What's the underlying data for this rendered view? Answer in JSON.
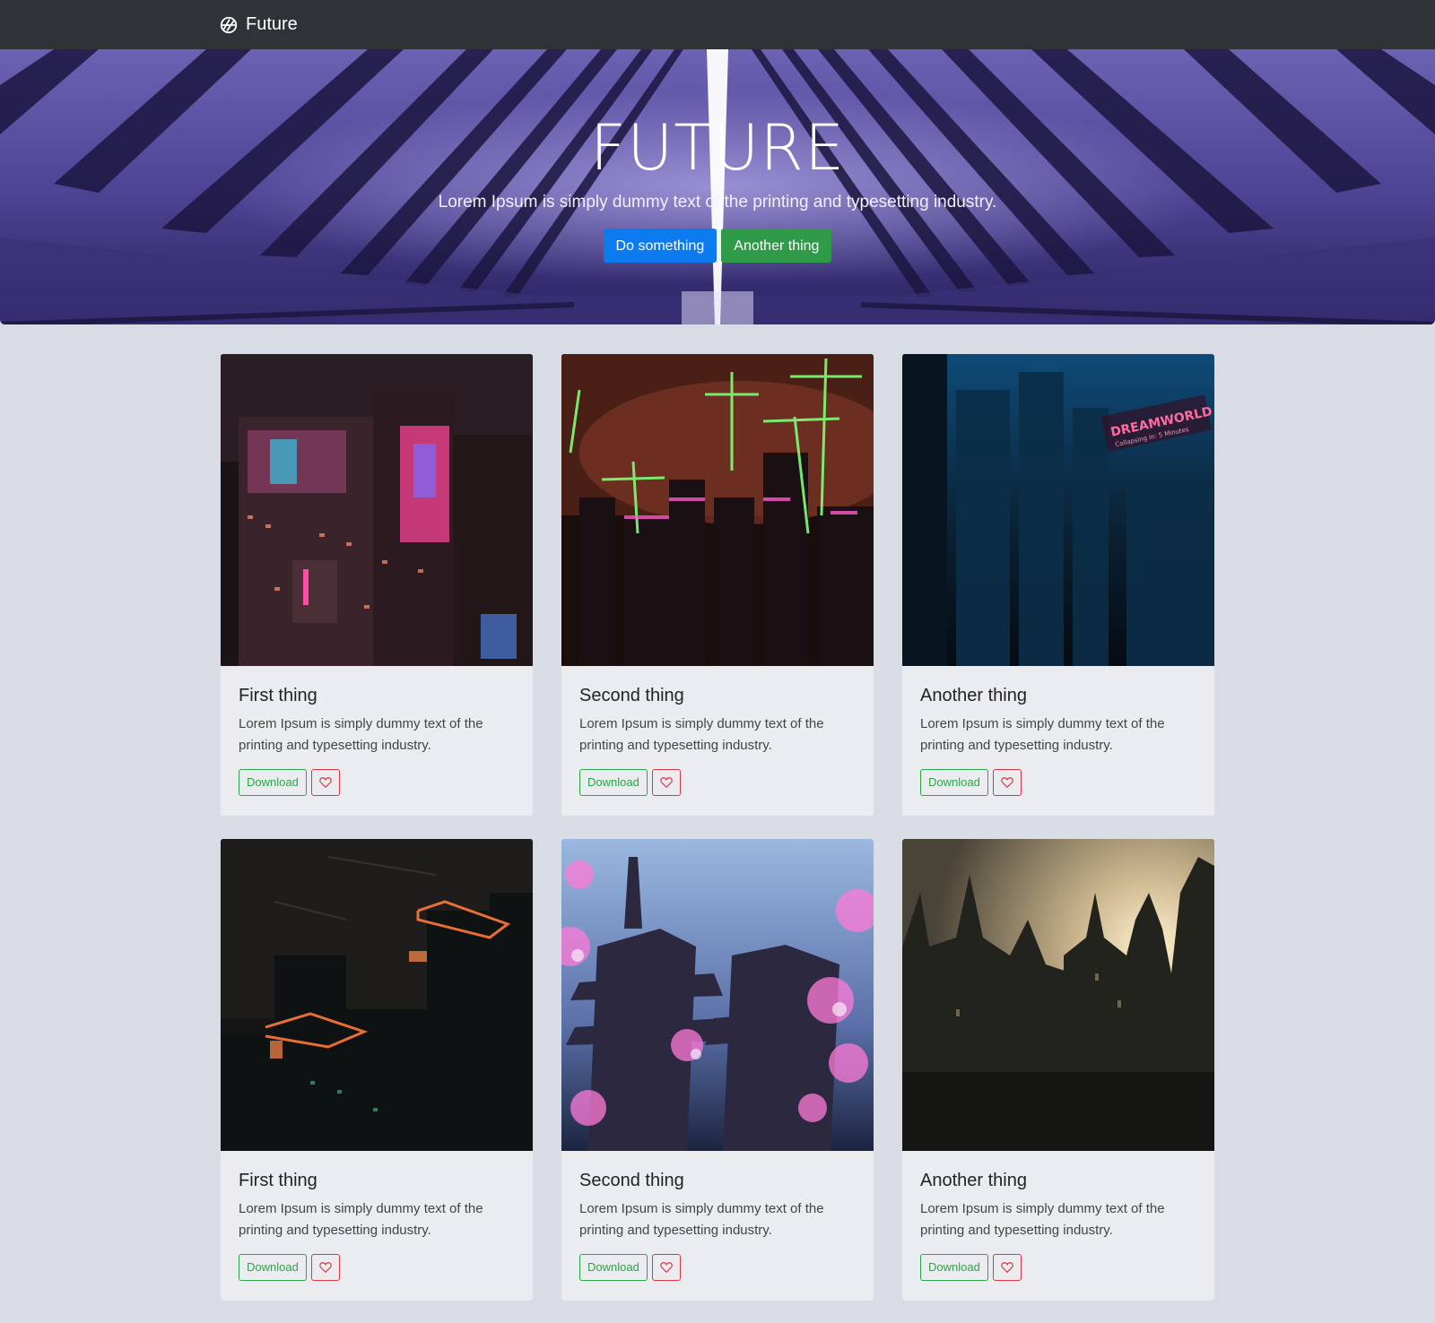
{
  "navbar": {
    "brand": "Future",
    "icon": "camera-aperture-icon"
  },
  "hero": {
    "title": "FUTURE",
    "subtitle": "Lorem Ipsum is simply dummy text of the printing and typesetting industry.",
    "primary_button": "Do something",
    "secondary_button": "Another thing"
  },
  "colors": {
    "primary": "#0d7bf0",
    "success": "#28a745",
    "danger": "#dc3545",
    "navbar": "#2f3338"
  },
  "cards": [
    {
      "title": "First thing",
      "text": "Lorem Ipsum is simply dummy text of the printing and typesetting industry.",
      "download": "Download",
      "image": "neon-city-billboards"
    },
    {
      "title": "Second thing",
      "text": "Lorem Ipsum is simply dummy text of the printing and typesetting industry.",
      "download": "Download",
      "image": "green-neon-crosses-skyline"
    },
    {
      "title": "Another thing",
      "text": "Lorem Ipsum is simply dummy text of the printing and typesetting industry.",
      "download": "Download",
      "image": "blue-dreamworld-city"
    },
    {
      "title": "First thing",
      "text": "Lorem Ipsum is simply dummy text of the printing and typesetting industry.",
      "download": "Download",
      "image": "orange-neon-construction"
    },
    {
      "title": "Second thing",
      "text": "Lorem Ipsum is simply dummy text of the printing and typesetting industry.",
      "download": "Download",
      "image": "pagoda-cherry-blossoms"
    },
    {
      "title": "Another thing",
      "text": "Lorem Ipsum is simply dummy text of the printing and typesetting industry.",
      "download": "Download",
      "image": "gothic-castle-sunset"
    }
  ],
  "image_text": {
    "sign_main": "DREAMWORLD",
    "sign_sub": "Collapsing in: 5 Minutes"
  }
}
